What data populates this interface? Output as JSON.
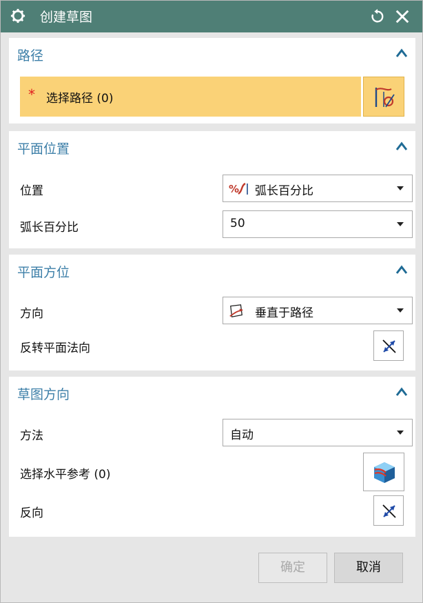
{
  "window": {
    "title": "创建草图",
    "title_bar_color": "#4f7f76",
    "icons": [
      "gear-icon",
      "reset-icon",
      "close-icon"
    ]
  },
  "path_group": {
    "title": "路径",
    "required_marker": "*",
    "select_label": "选择路径 (0)",
    "highlight_color": "#fad277",
    "section_color": "#3d7fa8"
  },
  "plane_location": {
    "title": "平面位置",
    "location_label": "位置",
    "location_value": "弧长百分比",
    "arc_percent_label": "弧长百分比",
    "arc_percent_value": "50"
  },
  "plane_orientation": {
    "title": "平面方位",
    "direction_label": "方向",
    "direction_value": "垂直于路径",
    "reverse_normal_label": "反转平面法向"
  },
  "sketch_orientation": {
    "title": "草图方向",
    "method_label": "方法",
    "method_value": "自动",
    "horizontal_ref_label": "选择水平参考 (0)",
    "reverse_label": "反向"
  },
  "footer": {
    "ok_label": "确定",
    "cancel_label": "取消"
  }
}
